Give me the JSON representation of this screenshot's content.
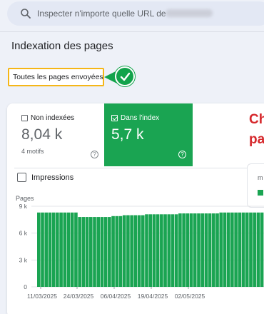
{
  "search": {
    "placeholder": "Inspecter n'importe quelle URL de"
  },
  "page": {
    "title": "Indexation des pages"
  },
  "filter": {
    "label": "Toutes les pages envoyées"
  },
  "metrics": {
    "not_indexed": {
      "label": "Non indexées",
      "value": "8,04 k",
      "sub": "4 motifs"
    },
    "indexed": {
      "label": "Dans l'index",
      "value": "5,7 k"
    }
  },
  "annotation": {
    "line1": "Ch",
    "line2": "pa"
  },
  "impressions": {
    "label": "Impressions",
    "checked": false
  },
  "legend": {
    "label": "m"
  },
  "colors": {
    "accent_green": "#1aa452",
    "highlight_yellow": "#f5b617",
    "annotation_red": "#d6282c"
  },
  "chart_data": {
    "type": "bar",
    "ylabel": "Pages",
    "y_ticks": [
      "0",
      "3 k",
      "6 k",
      "9 k"
    ],
    "ylim": [
      0,
      9000
    ],
    "x_ticks": [
      "11/03/2025",
      "24/03/2025",
      "06/04/2025",
      "19/04/2025",
      "02/05/2025"
    ],
    "series": [
      {
        "values": [
          8300,
          8300,
          8300,
          8300,
          8300,
          8300,
          8300,
          8300,
          8300,
          8300,
          8300,
          7800,
          7800,
          7800,
          7800,
          7800,
          7800,
          7800,
          7800,
          7800,
          7900,
          7900,
          7900,
          8000,
          8000,
          8000,
          8000,
          8000,
          8000,
          8100,
          8100,
          8100,
          8100,
          8100,
          8100,
          8100,
          8100,
          8100,
          8200,
          8200,
          8200,
          8200,
          8200,
          8200,
          8200,
          8200,
          8200,
          8200,
          8200,
          8300,
          8300,
          8300,
          8300,
          8300,
          8300,
          8300,
          8300,
          8300,
          8300,
          8300,
          8300
        ]
      }
    ]
  }
}
